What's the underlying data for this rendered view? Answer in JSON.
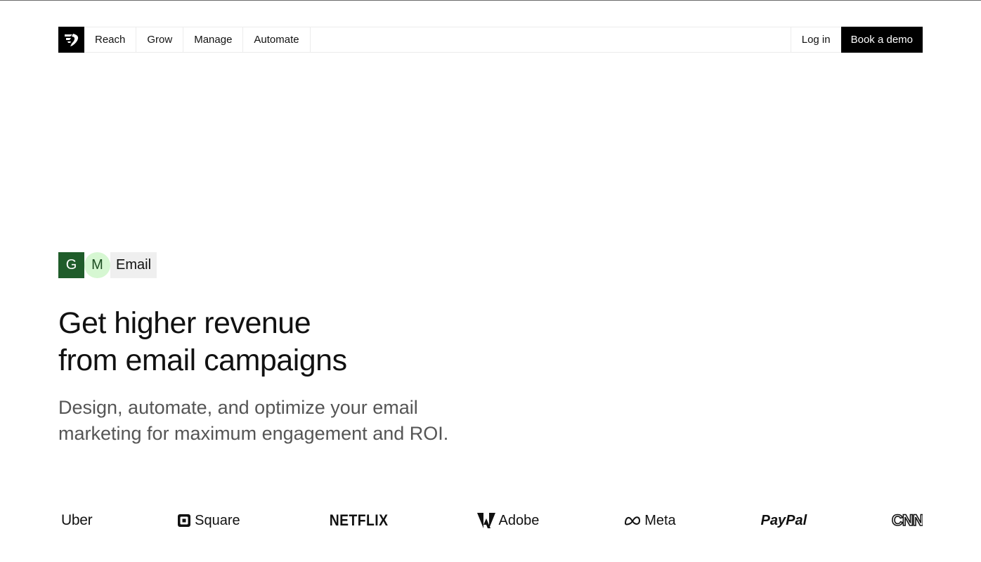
{
  "nav": {
    "logo_icon": "brand-bird-logo-icon",
    "items": [
      {
        "label": "Reach"
      },
      {
        "label": "Grow"
      },
      {
        "label": "Manage"
      },
      {
        "label": "Automate"
      }
    ],
    "login_label": "Log in",
    "cta_label": "Book a demo"
  },
  "hero": {
    "tags": {
      "g": "G",
      "m": "M",
      "email": "Email"
    },
    "headline_line1": "Get higher revenue",
    "headline_line2": "from email campaigns",
    "subhead_line1": "Design, automate, and optimize your email",
    "subhead_line2": "marketing for maximum engagement and ROI."
  },
  "logos": [
    {
      "name": "Uber",
      "icon": ""
    },
    {
      "name": "Square",
      "icon": "square-logo-icon"
    },
    {
      "name": "NETFLIX",
      "icon": ""
    },
    {
      "name": "Adobe",
      "icon": "adobe-logo-icon"
    },
    {
      "name": "Meta",
      "icon": "meta-logo-icon"
    },
    {
      "name": "PayPal",
      "icon": ""
    },
    {
      "name": "CNN",
      "icon": ""
    }
  ],
  "colors": {
    "accent_dark_green": "#1f5c2a",
    "accent_light_green": "#d6f7d2",
    "cta_background": "#000000"
  }
}
